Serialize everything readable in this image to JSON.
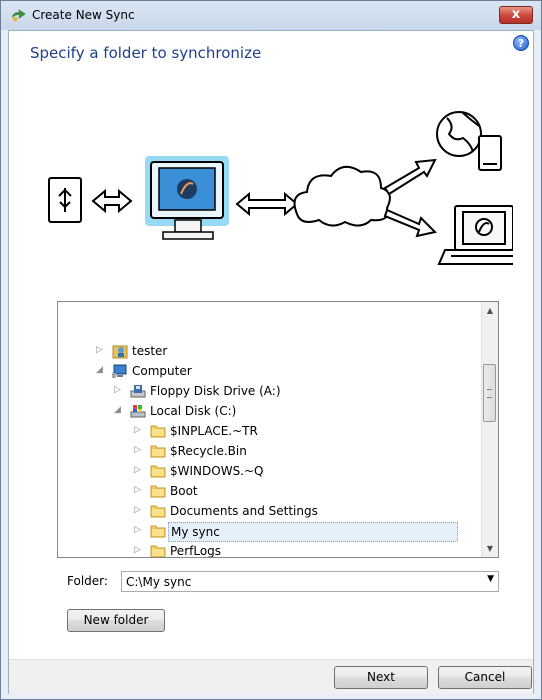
{
  "window": {
    "title": "Create New Sync",
    "close_label": "x"
  },
  "heading": "Specify a folder to synchronize",
  "help": "?",
  "tree": {
    "rows": [
      {
        "label": "tester",
        "expander": "▷",
        "icon": "user-folder-icon"
      },
      {
        "label": "Computer",
        "expander": "◢",
        "icon": "computer-icon"
      },
      {
        "label": "Floppy Disk Drive (A:)",
        "expander": "▷",
        "icon": "floppy-drive-icon"
      },
      {
        "label": "Local Disk (C:)",
        "expander": "◢",
        "icon": "local-disk-icon"
      },
      {
        "label": "$INPLACE.~TR",
        "expander": "▷",
        "icon": "folder-icon"
      },
      {
        "label": "$Recycle.Bin",
        "expander": "▷",
        "icon": "folder-icon"
      },
      {
        "label": "$WINDOWS.~Q",
        "expander": "▷",
        "icon": "folder-icon"
      },
      {
        "label": "Boot",
        "expander": "▷",
        "icon": "folder-icon"
      },
      {
        "label": "Documents and Settings",
        "expander": "▷",
        "icon": "folder-icon"
      },
      {
        "label": "My sync",
        "expander": "▷",
        "icon": "folder-icon"
      },
      {
        "label": "PerfLogs",
        "expander": "▷",
        "icon": "folder-icon"
      }
    ]
  },
  "folder": {
    "label": "Folder:",
    "value": "C:\\My sync"
  },
  "buttons": {
    "new_folder": "New folder",
    "next": "Next",
    "cancel": "Cancel"
  }
}
